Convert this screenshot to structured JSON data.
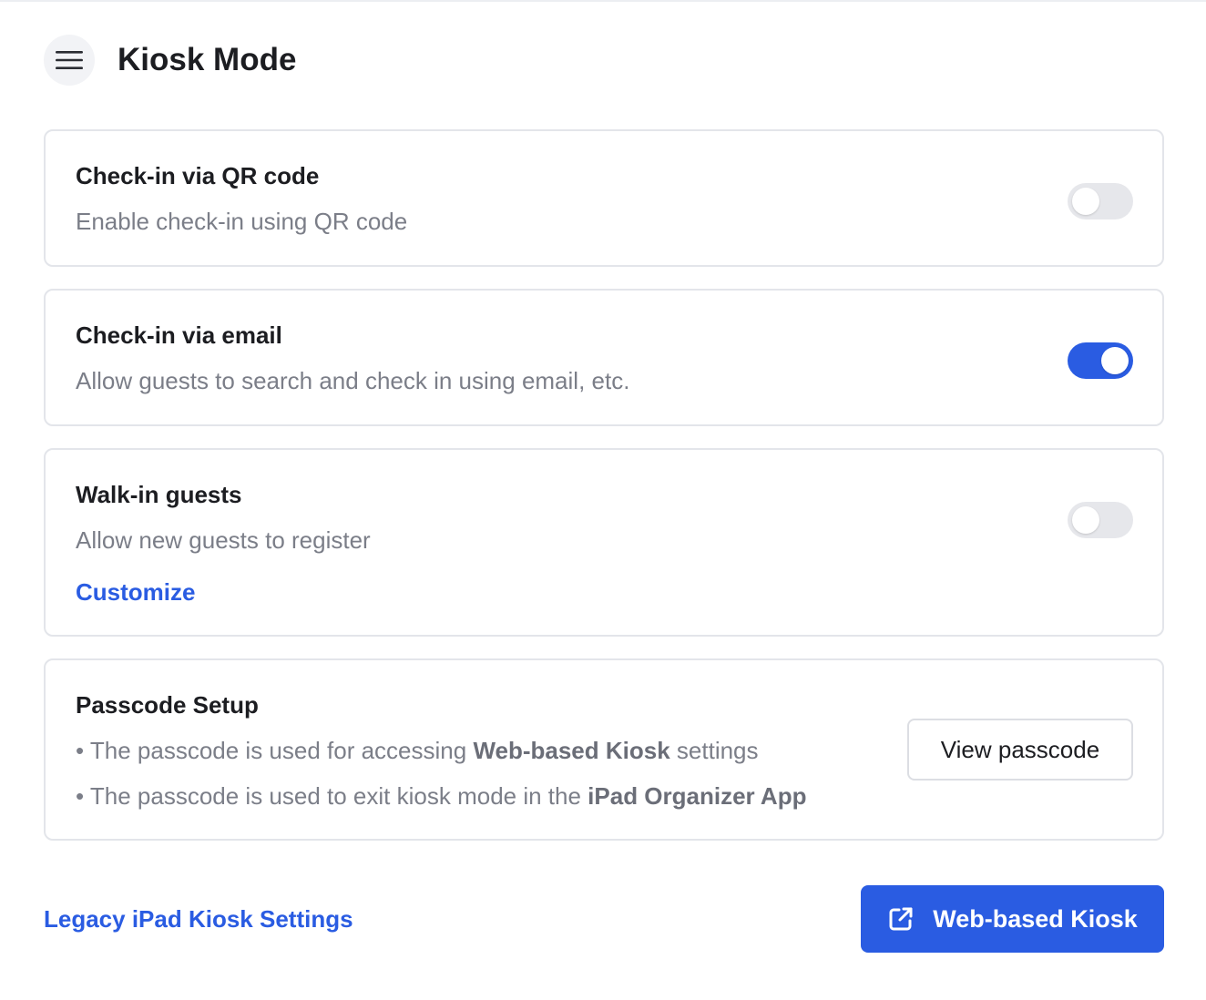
{
  "header": {
    "title": "Kiosk Mode",
    "menu_icon": "hamburger-menu-icon"
  },
  "settings": {
    "qr": {
      "title": "Check-in via QR code",
      "description": "Enable check-in using QR code",
      "enabled": false
    },
    "email": {
      "title": "Check-in via email",
      "description": "Allow guests to search and check in using email, etc.",
      "enabled": true
    },
    "walkin": {
      "title": "Walk-in guests",
      "description": "Allow new guests to register",
      "enabled": false,
      "customize_label": "Customize"
    }
  },
  "passcode": {
    "title": "Passcode Setup",
    "bullet1_prefix": "The passcode is used for accessing ",
    "bullet1_bold": "Web-based Kiosk",
    "bullet1_suffix": " settings",
    "bullet2_prefix": "The passcode is used to exit kiosk mode in the ",
    "bullet2_bold": "iPad Organizer App",
    "bullet_char": "•",
    "view_button_label": "View passcode"
  },
  "footer": {
    "legacy_link_label": "Legacy iPad Kiosk Settings",
    "web_kiosk_button_label": "Web-based Kiosk",
    "web_kiosk_icon": "external-link-icon"
  },
  "colors": {
    "accent": "#2a5ce2",
    "toggle_off": "#e6e7eb",
    "border": "#e3e5ea",
    "muted_text": "#7b7e88"
  }
}
